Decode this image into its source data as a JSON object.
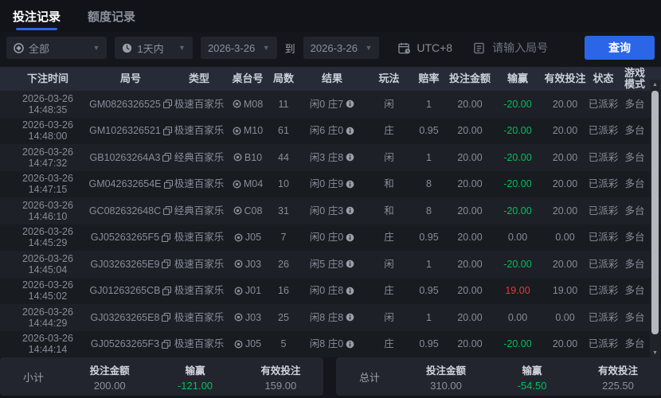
{
  "tabs": [
    {
      "label": "投注记录",
      "active": true
    },
    {
      "label": "额度记录",
      "active": false
    }
  ],
  "filters": {
    "category": "全部",
    "period": "1天内",
    "date_from": "2026-3-26",
    "date_to_label": "到",
    "date_to": "2026-3-26",
    "timezone": "UTC+8",
    "round_placeholder": "请输入局号",
    "search_label": "查询"
  },
  "icons": {
    "category": "target-icon",
    "period": "clock-icon",
    "date_caret": "chevron-down-icon",
    "timezone": "calendar-clock-icon",
    "round_input": "document-icon",
    "round_copy": "copy-icon",
    "table_replay": "record-icon",
    "result_info": "info-icon",
    "scrollbar": [
      "scrollbar-up-arrow",
      "scrollbar-down-arrow"
    ]
  },
  "table": {
    "headers": [
      "下注时间",
      "局号",
      "类型",
      "桌台号",
      "局数",
      "结果",
      "玩法",
      "赔率",
      "投注金额",
      "输赢",
      "有效投注",
      "状态",
      "游戏模式"
    ],
    "rows": [
      {
        "date": "2026-03-26",
        "time": "14:48:35",
        "round": "GM0826326525",
        "type": "极速百家乐",
        "table": "M08",
        "games": "11",
        "result": "闲0 庄7",
        "play": "闲",
        "odds": "1",
        "amount": "20.00",
        "winloss": "-20.00",
        "wl": "loss",
        "valid": "20.00",
        "status": "已派彩",
        "mode": "多台"
      },
      {
        "date": "2026-03-26",
        "time": "14:48:00",
        "round": "GM1026326521",
        "type": "极速百家乐",
        "table": "M10",
        "games": "61",
        "result": "闲6 庄0",
        "play": "庄",
        "odds": "0.95",
        "amount": "20.00",
        "winloss": "-20.00",
        "wl": "loss",
        "valid": "20.00",
        "status": "已派彩",
        "mode": "多台"
      },
      {
        "date": "2026-03-26",
        "time": "14:47:32",
        "round": "GB10263264A3",
        "type": "经典百家乐",
        "table": "B10",
        "games": "44",
        "result": "闲3 庄8",
        "play": "闲",
        "odds": "1",
        "amount": "20.00",
        "winloss": "-20.00",
        "wl": "loss",
        "valid": "20.00",
        "status": "已派彩",
        "mode": "多台"
      },
      {
        "date": "2026-03-26",
        "time": "14:47:15",
        "round": "GM042632654E",
        "type": "极速百家乐",
        "table": "M04",
        "games": "10",
        "result": "闲0 庄9",
        "play": "和",
        "odds": "8",
        "amount": "20.00",
        "winloss": "-20.00",
        "wl": "loss",
        "valid": "20.00",
        "status": "已派彩",
        "mode": "多台"
      },
      {
        "date": "2026-03-26",
        "time": "14:46:10",
        "round": "GC082632648C",
        "type": "经典百家乐",
        "table": "C08",
        "games": "31",
        "result": "闲0 庄3",
        "play": "和",
        "odds": "8",
        "amount": "20.00",
        "winloss": "-20.00",
        "wl": "loss",
        "valid": "20.00",
        "status": "已派彩",
        "mode": "多台"
      },
      {
        "date": "2026-03-26",
        "time": "14:45:29",
        "round": "GJ05263265F5",
        "type": "极速百家乐",
        "table": "J05",
        "games": "7",
        "result": "闲0 庄0",
        "play": "庄",
        "odds": "0.95",
        "amount": "20.00",
        "winloss": "0.00",
        "wl": "flat",
        "valid": "0.00",
        "status": "已派彩",
        "mode": "多台"
      },
      {
        "date": "2026-03-26",
        "time": "14:45:04",
        "round": "GJ03263265E9",
        "type": "极速百家乐",
        "table": "J03",
        "games": "26",
        "result": "闲5 庄8",
        "play": "闲",
        "odds": "1",
        "amount": "20.00",
        "winloss": "-20.00",
        "wl": "loss",
        "valid": "20.00",
        "status": "已派彩",
        "mode": "多台"
      },
      {
        "date": "2026-03-26",
        "time": "14:45:02",
        "round": "GJ01263265CB",
        "type": "极速百家乐",
        "table": "J01",
        "games": "16",
        "result": "闲0 庄8",
        "play": "庄",
        "odds": "0.95",
        "amount": "20.00",
        "winloss": "19.00",
        "wl": "win",
        "valid": "19.00",
        "status": "已派彩",
        "mode": "多台"
      },
      {
        "date": "2026-03-26",
        "time": "14:44:29",
        "round": "GJ03263265E8",
        "type": "极速百家乐",
        "table": "J03",
        "games": "25",
        "result": "闲8 庄8",
        "play": "闲",
        "odds": "1",
        "amount": "20.00",
        "winloss": "0.00",
        "wl": "flat",
        "valid": "0.00",
        "status": "已派彩",
        "mode": "多台"
      },
      {
        "date": "2026-03-26",
        "time": "14:44:14",
        "round": "GJ05263265F3",
        "type": "极速百家乐",
        "table": "J05",
        "games": "5",
        "result": "闲8 庄0",
        "play": "庄",
        "odds": "0.95",
        "amount": "20.00",
        "winloss": "-20.00",
        "wl": "loss",
        "valid": "20.00",
        "status": "已派彩",
        "mode": "多台"
      }
    ]
  },
  "summary": {
    "subtotal": {
      "label": "小计",
      "amount_label": "投注金额",
      "amount": "200.00",
      "winloss_label": "输赢",
      "winloss": "-121.00",
      "valid_label": "有效投注",
      "valid": "159.00"
    },
    "total": {
      "label": "总计",
      "amount_label": "投注金额",
      "amount": "310.00",
      "winloss_label": "输赢",
      "winloss": "-54.50",
      "valid_label": "有效投注",
      "valid": "225.50"
    }
  },
  "colors": {
    "accent_blue": "#2c66e8",
    "loss_green": "#00c05a",
    "win_red": "#e13a3a",
    "header_bg": "#272b37"
  }
}
